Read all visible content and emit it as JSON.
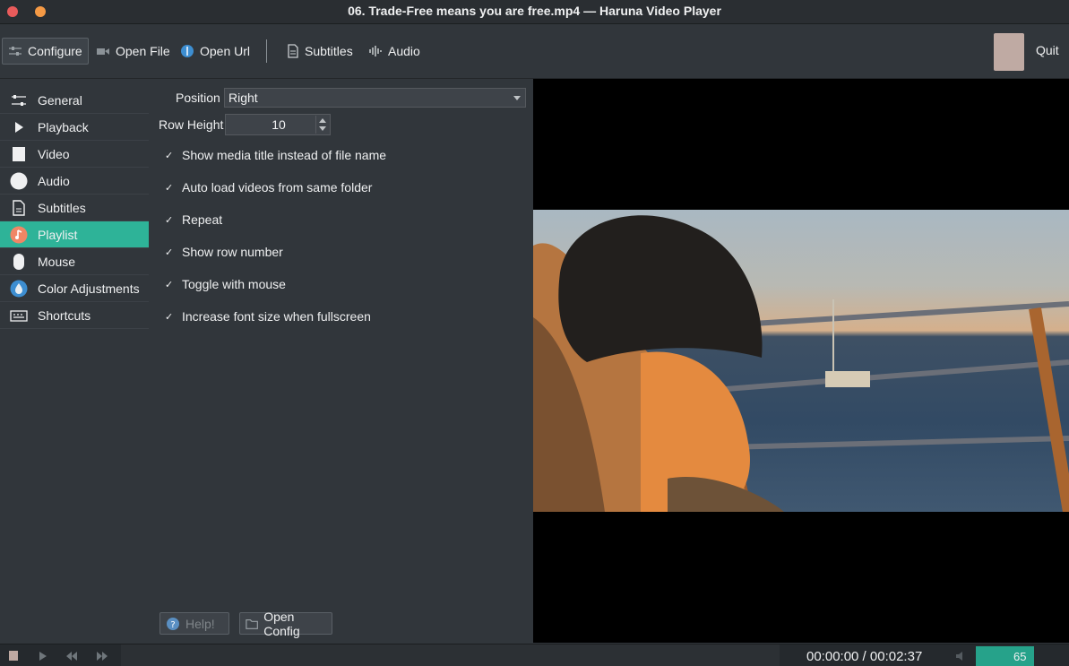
{
  "window": {
    "title": "06. Trade-Free means you are free.mp4 — Haruna Video Player"
  },
  "toolbar": {
    "configure": "Configure",
    "open_file": "Open File",
    "open_url": "Open Url",
    "subtitles": "Subtitles",
    "audio": "Audio",
    "quit": "Quit"
  },
  "sidebar": {
    "items": [
      {
        "label": "General",
        "icon": "sliders-icon"
      },
      {
        "label": "Playback",
        "icon": "play-icon"
      },
      {
        "label": "Video",
        "icon": "video-icon"
      },
      {
        "label": "Audio",
        "icon": "audio-icon"
      },
      {
        "label": "Subtitles",
        "icon": "document-icon"
      },
      {
        "label": "Playlist",
        "icon": "music-note-icon",
        "selected": true
      },
      {
        "label": "Mouse",
        "icon": "mouse-icon"
      },
      {
        "label": "Color Adjustments",
        "icon": "color-icon"
      },
      {
        "label": "Shortcuts",
        "icon": "keyboard-icon"
      }
    ]
  },
  "settings": {
    "position_label": "Position",
    "position_value": "Right",
    "row_height_label": "Row Height",
    "row_height_value": "10",
    "checkboxes": [
      {
        "label": "Show media title instead of file name",
        "checked": true
      },
      {
        "label": "Auto load videos from same folder",
        "checked": true
      },
      {
        "label": "Repeat",
        "checked": true
      },
      {
        "label": "Show row number",
        "checked": true
      },
      {
        "label": "Toggle with mouse",
        "checked": true
      },
      {
        "label": "Increase font size when fullscreen",
        "checked": true
      }
    ],
    "help_button": "Help!",
    "open_config_button": "Open Config"
  },
  "player": {
    "time": "00:00:00 / 00:02:37",
    "volume": "65"
  },
  "colors": {
    "accent": "#2eb398",
    "background": "#31363b"
  }
}
